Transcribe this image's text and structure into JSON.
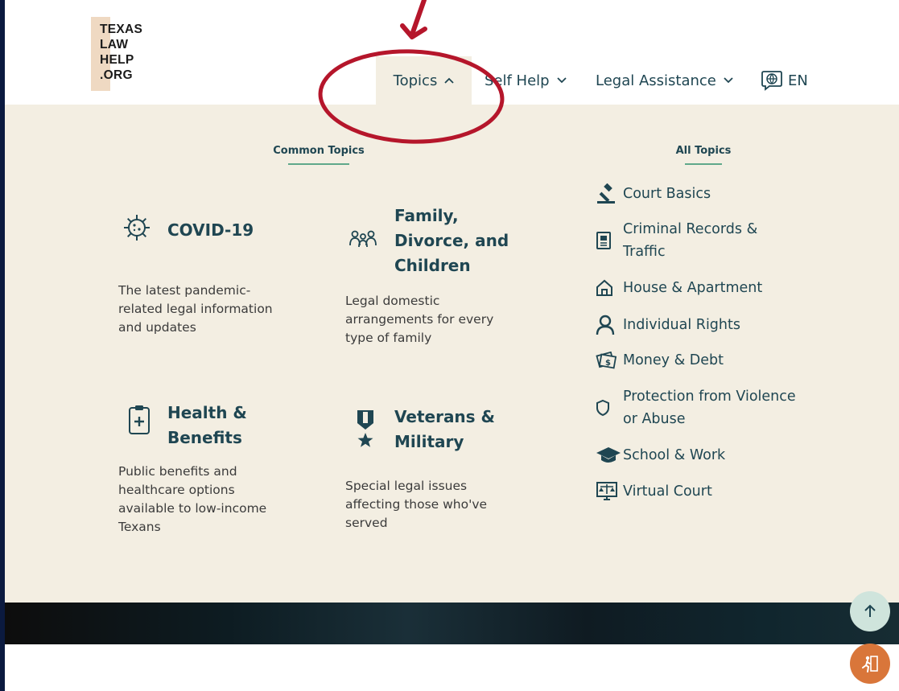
{
  "logo": {
    "lines": [
      "TEXAS",
      "LAW",
      "HELP",
      ".ORG"
    ]
  },
  "nav": {
    "topics": "Topics",
    "self_help": "Self Help",
    "legal_assistance": "Legal Assistance",
    "language": "EN"
  },
  "menu": {
    "common_heading": "Common Topics",
    "all_heading": "All Topics",
    "cards": [
      {
        "title": "COVID-19",
        "description": [
          "The latest pandemic-",
          "related legal information",
          "and updates"
        ],
        "icon": "virus-icon"
      },
      {
        "title": "Family, Divorce, and Children",
        "title_lines": [
          "Family,",
          "Divorce, and",
          "Children"
        ],
        "description": [
          "Legal domestic",
          "arrangements for every",
          "type of family"
        ],
        "icon": "family-icon"
      },
      {
        "title": "Health & Benefits",
        "title_lines": [
          "Health &",
          "Benefits"
        ],
        "description": [
          "Public benefits and",
          "healthcare options",
          "available to low-income",
          "Texans"
        ],
        "icon": "clipboard-medical-icon"
      },
      {
        "title": "Veterans & Military",
        "title_lines": [
          "Veterans &",
          "Military"
        ],
        "description": [
          "Special legal issues",
          "affecting those who've",
          "served"
        ],
        "icon": "medal-icon"
      }
    ],
    "all_topics": [
      {
        "label": "Court Basics",
        "icon": "gavel-icon"
      },
      {
        "label": "Criminal Records & Traffic",
        "lines": [
          "Criminal Records &",
          "Traffic"
        ],
        "icon": "document-icon"
      },
      {
        "label": "House & Apartment",
        "icon": "house-icon"
      },
      {
        "label": "Individual Rights",
        "icon": "person-icon"
      },
      {
        "label": "Money & Debt",
        "icon": "money-icon"
      },
      {
        "label": "Protection from Violence or Abuse",
        "lines": [
          "Protection from Violence",
          "or Abuse"
        ],
        "icon": "shield-icon"
      },
      {
        "label": "School & Work",
        "icon": "graduation-cap-icon"
      },
      {
        "label": "Virtual Court",
        "icon": "scales-screen-icon"
      }
    ]
  },
  "colors": {
    "brand_teal": "#1f4652",
    "menu_background": "#f3eee2",
    "accent_green": "#5fa88a",
    "annotation_red": "#b5162b",
    "exit_orange": "#d9763a"
  }
}
